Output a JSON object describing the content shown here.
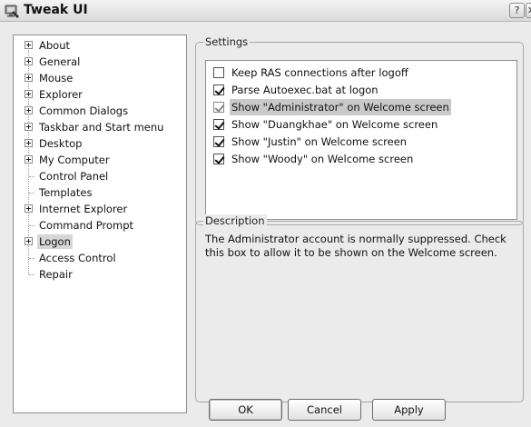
{
  "window": {
    "title": "Tweak UI",
    "help_glyph": "?",
    "close_glyph": "✕"
  },
  "tree": {
    "items": [
      {
        "label": "About",
        "expandable": true
      },
      {
        "label": "General",
        "expandable": true
      },
      {
        "label": "Mouse",
        "expandable": true
      },
      {
        "label": "Explorer",
        "expandable": true
      },
      {
        "label": "Common Dialogs",
        "expandable": true
      },
      {
        "label": "Taskbar and Start menu",
        "expandable": true
      },
      {
        "label": "Desktop",
        "expandable": true
      },
      {
        "label": "My Computer",
        "expandable": true
      },
      {
        "label": "Control Panel",
        "expandable": false
      },
      {
        "label": "Templates",
        "expandable": false
      },
      {
        "label": "Internet Explorer",
        "expandable": true
      },
      {
        "label": "Command Prompt",
        "expandable": false
      },
      {
        "label": "Logon",
        "expandable": true,
        "selected": true
      },
      {
        "label": "Access Control",
        "expandable": false
      },
      {
        "label": "Repair",
        "expandable": false
      }
    ]
  },
  "settings": {
    "legend": "Settings",
    "options": [
      {
        "label": "Keep RAS connections after logoff",
        "checked": false
      },
      {
        "label": "Parse Autoexec.bat at logon",
        "checked": true
      },
      {
        "label": "Show \"Administrator\" on Welcome screen",
        "checked": true,
        "highlighted": true
      },
      {
        "label": "Show \"Duangkhae\" on Welcome screen",
        "checked": true
      },
      {
        "label": "Show \"Justin\" on Welcome screen",
        "checked": true
      },
      {
        "label": "Show \"Woody\" on Welcome screen",
        "checked": true
      }
    ]
  },
  "description": {
    "legend": "Description",
    "text": "The Administrator account is normally suppressed.  Check this box to allow it to be shown on the Welcome screen."
  },
  "buttons": {
    "ok": "OK",
    "cancel": "Cancel",
    "apply": "Apply"
  }
}
